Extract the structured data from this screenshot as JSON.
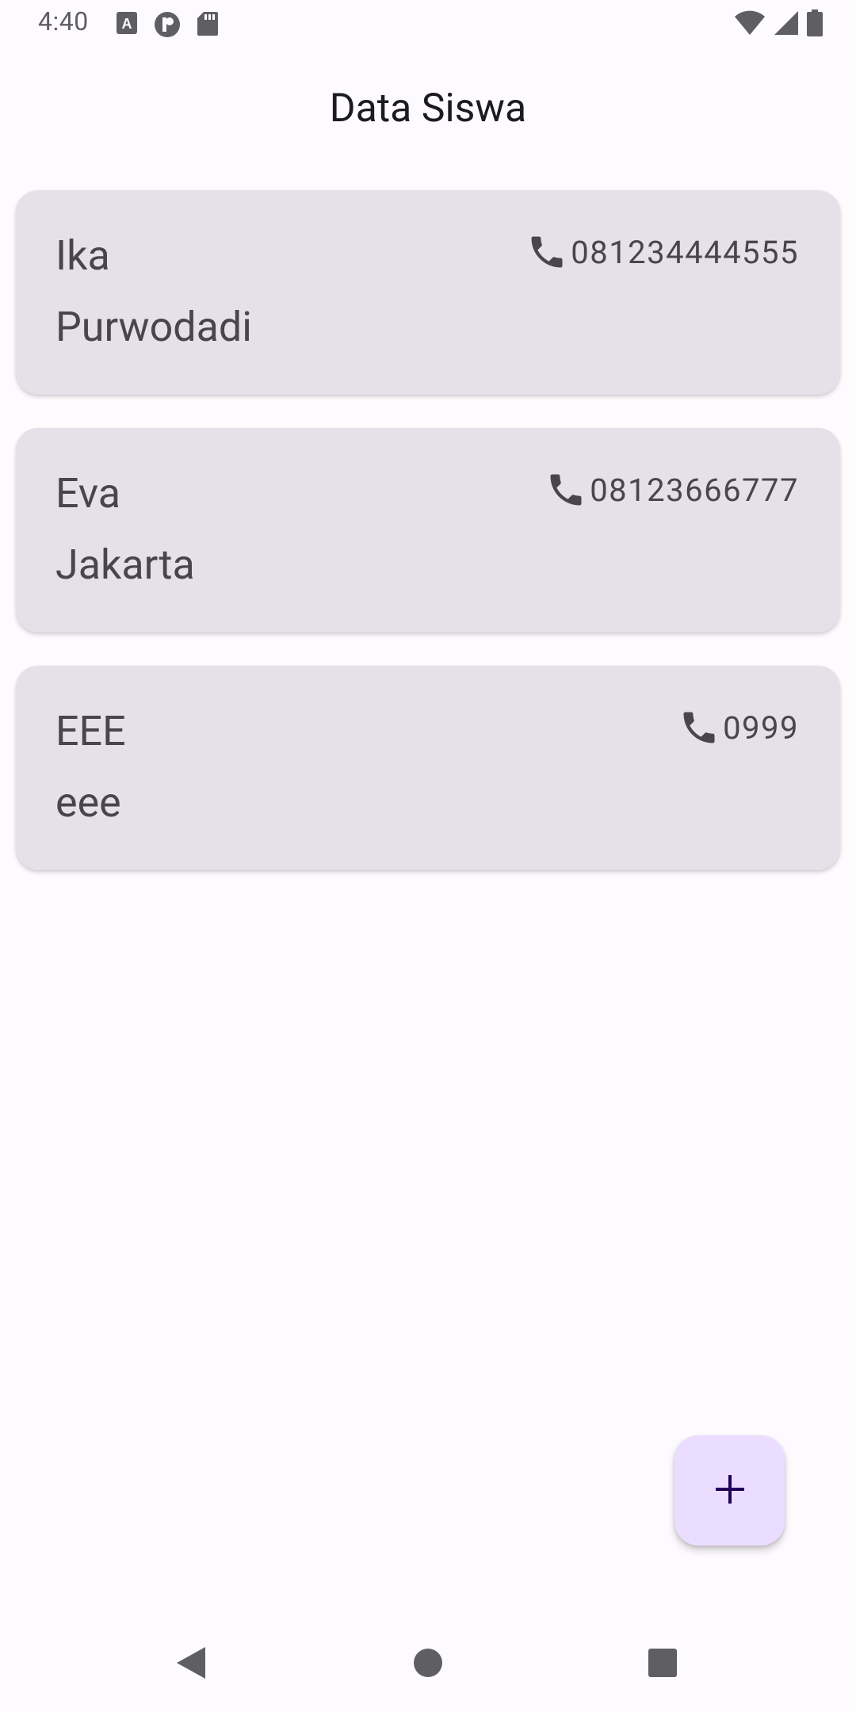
{
  "status_bar": {
    "time": "4:40",
    "left_icons": [
      "accessibility-a-icon",
      "circle-p-icon",
      "sd-card-icon"
    ],
    "right_icons": [
      "wifi-icon",
      "signal-icon",
      "battery-icon"
    ]
  },
  "app_bar": {
    "title": "Data Siswa"
  },
  "students": [
    {
      "name": "Ika",
      "city": "Purwodadi",
      "phone": "081234444555"
    },
    {
      "name": "Eva",
      "city": "Jakarta",
      "phone": "08123666777"
    },
    {
      "name": "EEE",
      "city": "eee",
      "phone": "0999"
    }
  ],
  "fab": {
    "icon": "plus-icon"
  },
  "nav_bar": {
    "buttons": [
      "back-icon",
      "home-icon",
      "recents-icon"
    ]
  },
  "colors": {
    "background": "#fefbfe",
    "card": "#e6e0e9",
    "card_text": "#49454f",
    "fab_bg": "#eaddff",
    "fab_icon": "#21005d"
  }
}
